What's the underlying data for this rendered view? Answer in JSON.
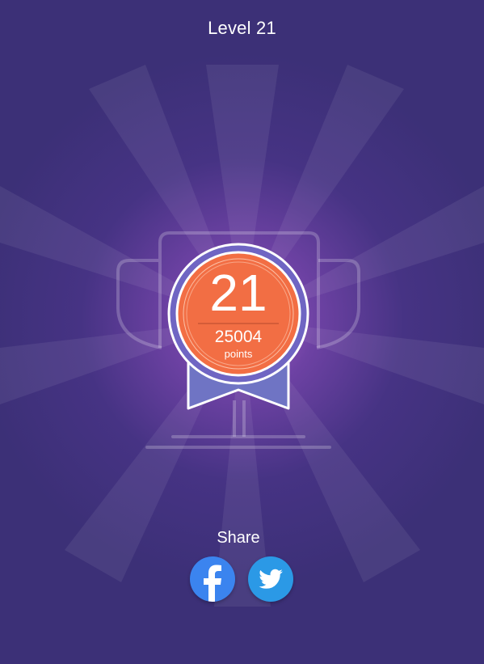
{
  "header": {
    "title": "Level 21"
  },
  "badge": {
    "level": "21",
    "points": "25004",
    "points_label": "points"
  },
  "share": {
    "label": "Share",
    "buttons": [
      {
        "name": "facebook",
        "icon": "facebook-icon"
      },
      {
        "name": "twitter",
        "icon": "twitter-icon"
      }
    ]
  },
  "colors": {
    "background": "#3c3077",
    "glow": "#b36ad8",
    "medal_orange": "#f26e44",
    "ribbon": "#6f74c4",
    "facebook": "#3b84ef",
    "twitter": "#2b99e6"
  }
}
